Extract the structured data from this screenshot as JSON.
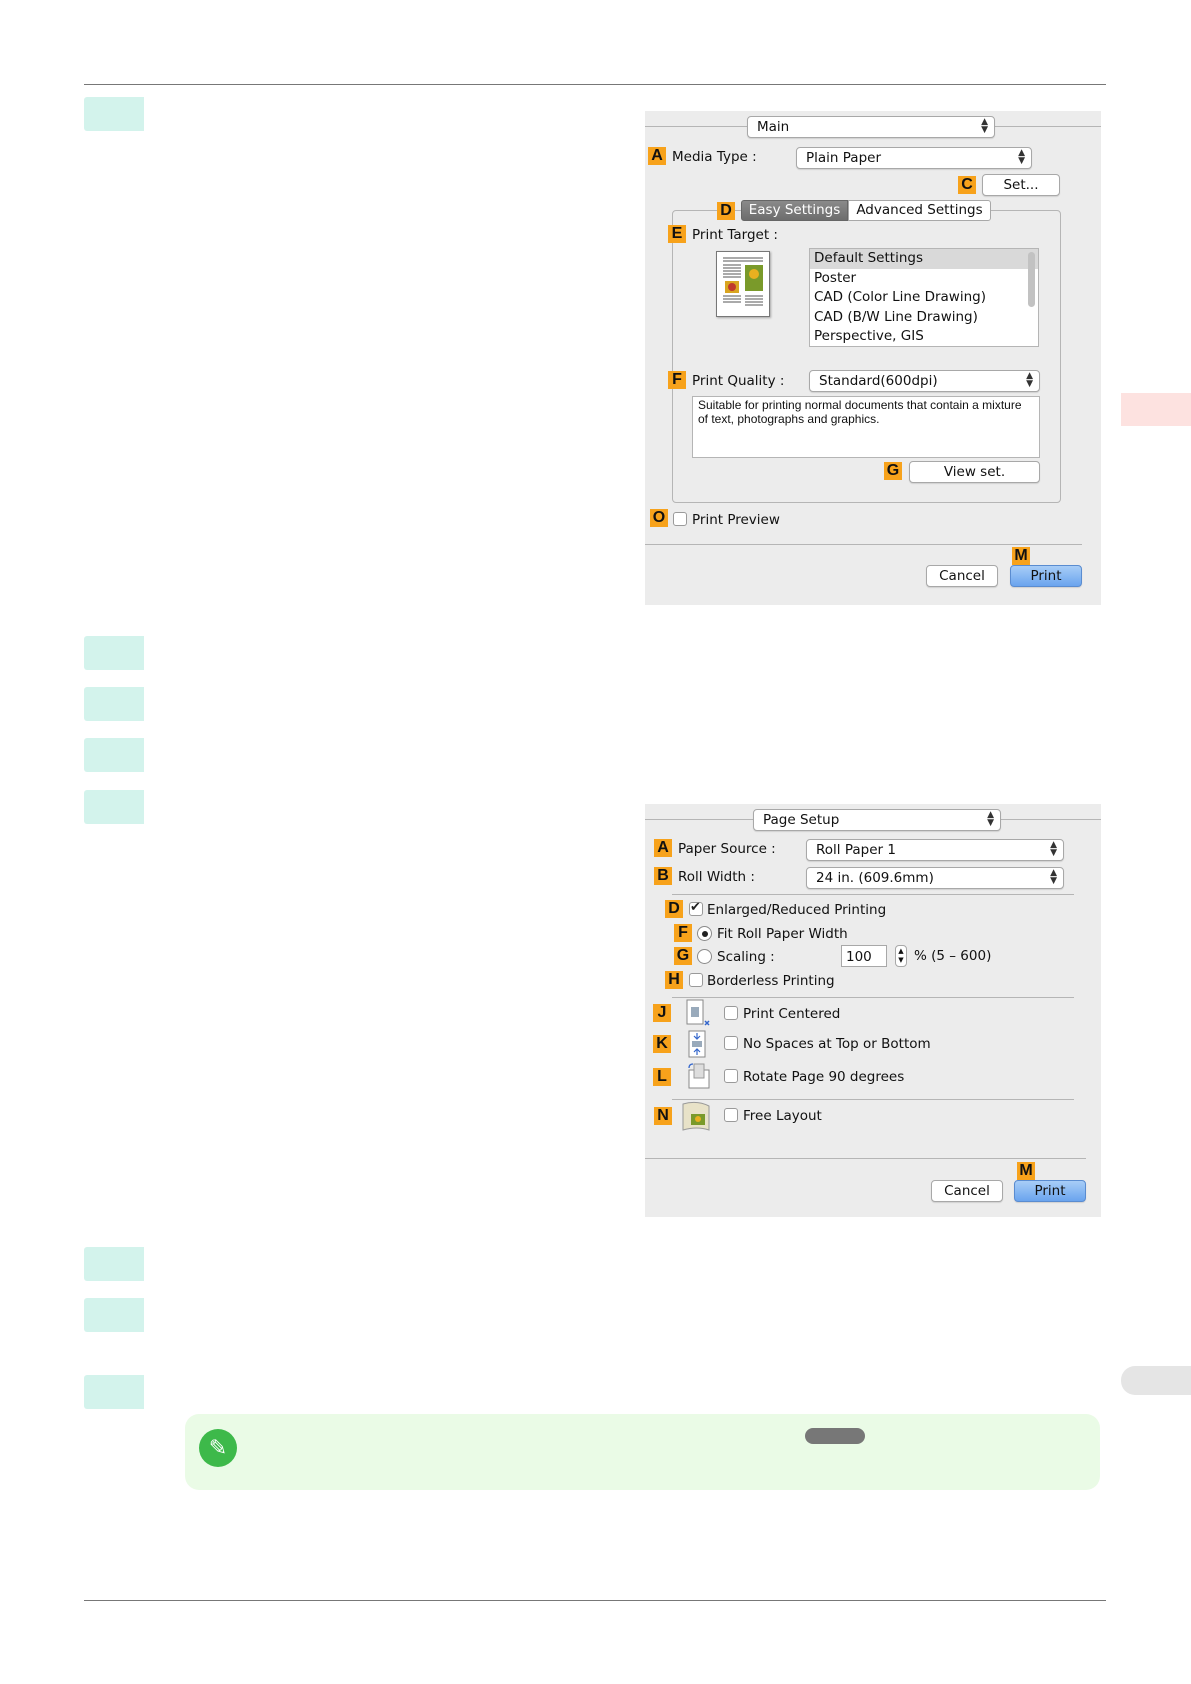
{
  "dialog_main": {
    "menu": "Main",
    "badges": {
      "media_type": "A",
      "set": "C",
      "tabs": "D",
      "print_target": "E",
      "print_quality": "F",
      "view_set": "G",
      "print_preview": "O",
      "print": "M"
    },
    "media_type_label": "Media Type :",
    "media_type_value": "Plain Paper",
    "set_button": "Set...",
    "tab_easy": "Easy Settings",
    "tab_advanced": "Advanced Settings",
    "print_target_label": "Print Target :",
    "print_target_items": [
      "Default Settings",
      "Poster",
      "CAD (Color Line Drawing)",
      "CAD (B/W Line Drawing)",
      "Perspective, GIS"
    ],
    "print_quality_label": "Print Quality :",
    "print_quality_value": "Standard(600dpi)",
    "description": "Suitable for printing normal documents that contain a mixture of text, photographs and graphics.",
    "view_set_button": "View set.",
    "print_preview_label": "Print Preview",
    "cancel": "Cancel",
    "print": "Print"
  },
  "dialog_page": {
    "menu": "Page Setup",
    "badges": {
      "paper_source": "A",
      "roll_width": "B",
      "enlarged": "D",
      "fit": "F",
      "scaling": "G",
      "borderless": "H",
      "centered": "J",
      "no_spaces": "K",
      "rotate": "L",
      "free_layout": "N",
      "print": "M"
    },
    "paper_source_label": "Paper Source :",
    "paper_source_value": "Roll Paper 1",
    "roll_width_label": "Roll Width :",
    "roll_width_value": "24 in. (609.6mm)",
    "enlarged_label": "Enlarged/Reduced Printing",
    "fit_label": "Fit Roll Paper Width",
    "scaling_label": "Scaling :",
    "scaling_value": "100",
    "scaling_range": "% (5 – 600)",
    "borderless_label": "Borderless Printing",
    "centered_label": "Print Centered",
    "no_spaces_label": "No Spaces at Top or Bottom",
    "rotate_label": "Rotate Page 90 degrees",
    "free_layout_label": "Free Layout",
    "cancel": "Cancel",
    "print": "Print"
  },
  "colors": {
    "badge": "#f7a21b",
    "step": "#d3f3ec",
    "note": "#eafbe6",
    "print_button": "#6aa4ee"
  }
}
